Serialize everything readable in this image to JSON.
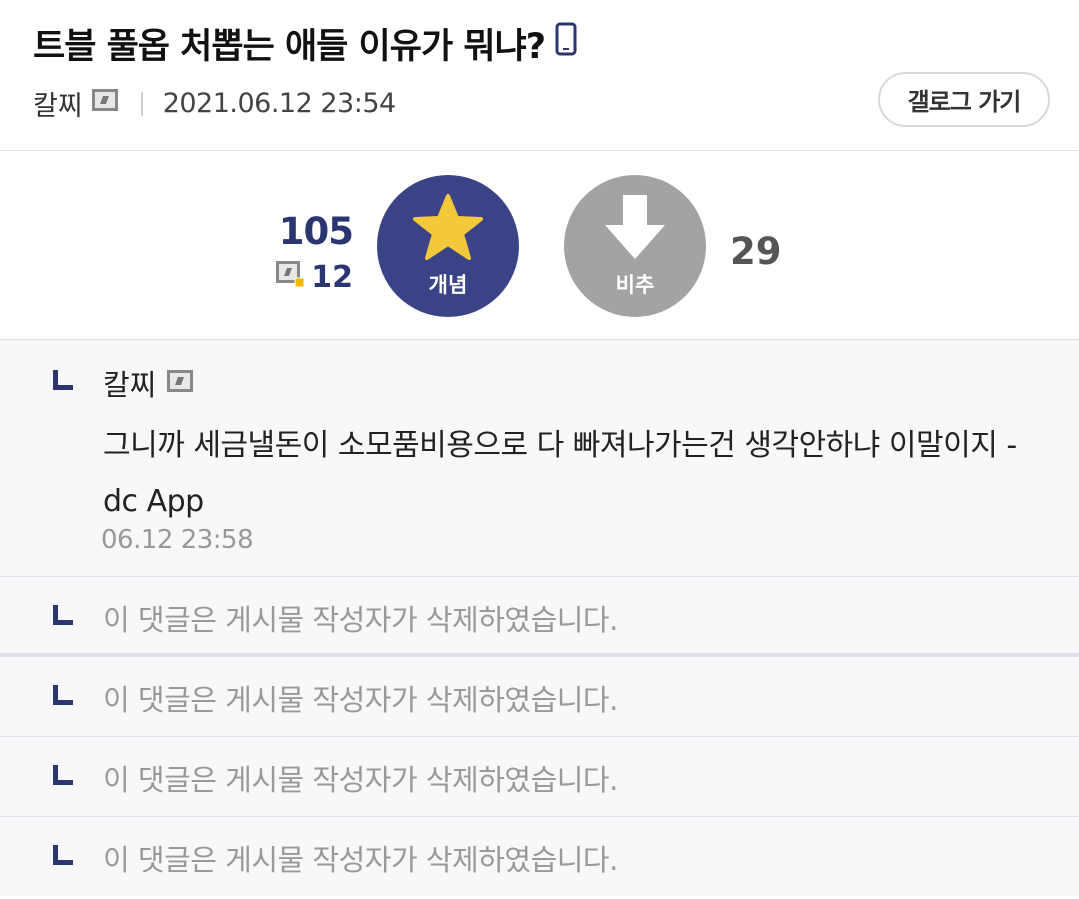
{
  "post": {
    "title": "트블 풀옵 처뽑는 애들 이유가 뭐냐?",
    "author": "칼찌",
    "date": "2021.06.12 23:54",
    "gallery_button": "갤로그 가기"
  },
  "vote": {
    "up_count": "105",
    "fix_count": "12",
    "up_label": "개념",
    "down_label": "비추",
    "down_count": "29"
  },
  "replies": [
    {
      "author": "칼찌",
      "body": "그니까 세금낼돈이 소모품비용으로 다 빠져나가는건 생각안하냐 이말이지 - dc App",
      "time": "06.12 23:58"
    }
  ],
  "deleted_replies": [
    "이 댓글은 게시물 작성자가 삭제하였습니다.",
    "이 댓글은 게시물 작성자가 삭제하였습니다.",
    "이 댓글은 게시물 작성자가 삭제하였습니다.",
    "이 댓글은 게시물 작성자가 삭제하였습니다."
  ],
  "icons": {
    "mobile": "mobile-phone-icon",
    "nick": "fixed-nick-icon",
    "star": "star-icon",
    "down_arrow": "down-arrow-icon",
    "reply_branch": "reply-branch-icon"
  },
  "colors": {
    "accent": "#3b4387",
    "accent_text": "#2b3670",
    "downvote": "#a3a3a6",
    "star": "#f3c93b",
    "reply_bg": "#f8f8fa"
  }
}
